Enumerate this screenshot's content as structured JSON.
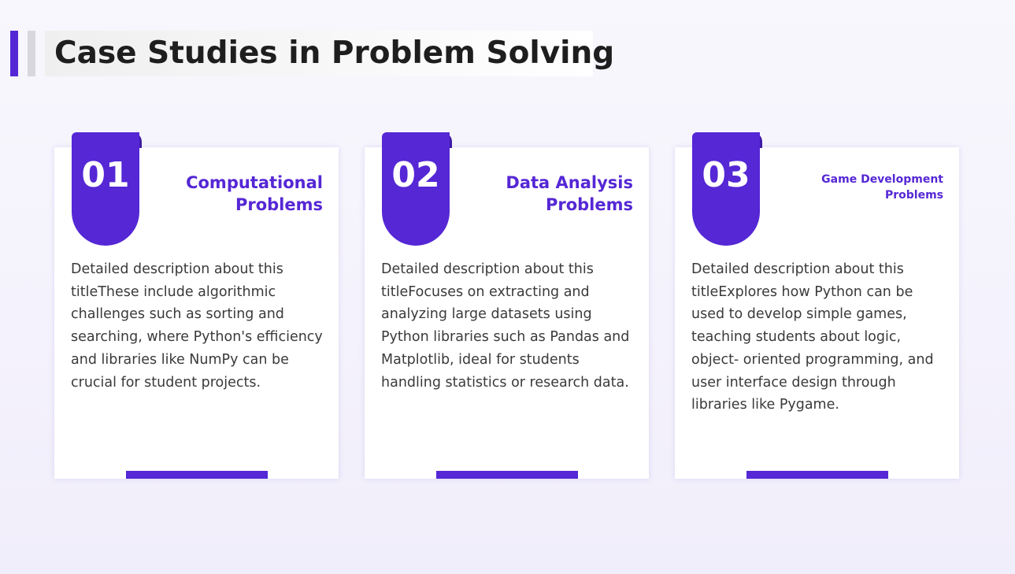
{
  "page": {
    "title": "Case Studies in Problem Solving"
  },
  "colors": {
    "accent": "#5527d5",
    "accent_dark": "#3f1aa8",
    "title_text": "#1e1e1e",
    "body_text": "#3a3a3a"
  },
  "cards": [
    {
      "number": "01",
      "heading_line1": "Computational",
      "heading_line2": "Problems",
      "body": "Detailed description about this titleThese include algorithmic challenges such as sorting and searching, where Python's efficiency and libraries like NumPy can be crucial for student projects."
    },
    {
      "number": "02",
      "heading_line1": "Data Analysis",
      "heading_line2": "Problems",
      "body": "Detailed description about this titleFocuses on extracting and analyzing large datasets using Python libraries such as Pandas and Matplotlib, ideal for students handling statistics or research data."
    },
    {
      "number": "03",
      "heading_line1": "Game Development",
      "heading_line2": "Problems",
      "body": "Detailed description about this titleExplores how Python can be used to develop simple games, teaching students about logic, object- oriented programming, and user interface design through libraries like Pygame."
    }
  ]
}
